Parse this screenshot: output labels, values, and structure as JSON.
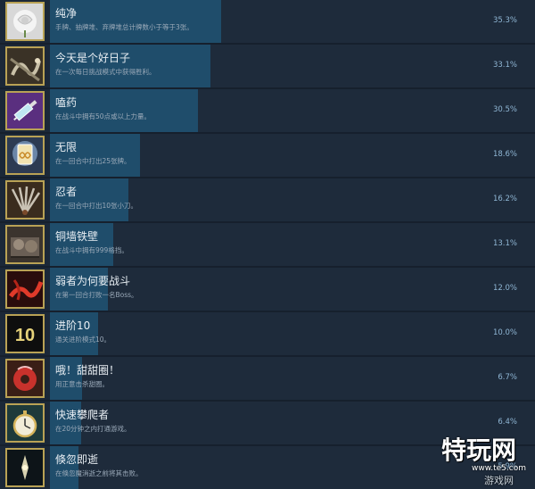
{
  "achievements": [
    {
      "icon": "white-rose-icon",
      "title": "纯净",
      "desc": "手牌、抽牌堆、弃牌堆总计牌数小于等于3张。",
      "percent": "35.3%",
      "progress": 35.3,
      "bg": "#d8d8d8"
    },
    {
      "icon": "serpent-coil-icon",
      "title": "今天是个好日子",
      "desc": "在一次每日挑战模式中获得胜利。",
      "percent": "33.1%",
      "progress": 33.1,
      "bg": "#3a3226"
    },
    {
      "icon": "syringe-icon",
      "title": "嗑药",
      "desc": "在战斗中拥有50点或以上力量。",
      "percent": "30.5%",
      "progress": 30.5,
      "bg": "#4a2a6a"
    },
    {
      "icon": "infinity-card-icon",
      "title": "无限",
      "desc": "在一回合中打出25张牌。",
      "percent": "18.6%",
      "progress": 18.6,
      "bg": "#2d3b52"
    },
    {
      "icon": "dagger-fan-icon",
      "title": "忍者",
      "desc": "在一回合中打出10张小刀。",
      "percent": "16.2%",
      "progress": 16.2,
      "bg": "#3a2c1e"
    },
    {
      "icon": "iron-wall-icon",
      "title": "铜墙铁壁",
      "desc": "在战斗中拥有999格挡。",
      "percent": "13.1%",
      "progress": 13.1,
      "bg": "#3b342e"
    },
    {
      "icon": "red-tendril-icon",
      "title": "弱者为何要战斗",
      "desc": "在第一回合打败一名Boss。",
      "percent": "12.0%",
      "progress": 12.0,
      "bg": "#3a1414"
    },
    {
      "icon": "ascension-10-icon",
      "title": "进阶10",
      "desc": "通关进阶模式10。",
      "percent": "10.0%",
      "progress": 10.0,
      "bg": "#141414"
    },
    {
      "icon": "donut-icon",
      "title": "哦！甜甜圈！",
      "desc": "用正意击杀甜圈。",
      "percent": "6.7%",
      "progress": 6.7,
      "bg": "#3a1e16"
    },
    {
      "icon": "pocket-watch-icon",
      "title": "快速攀爬者",
      "desc": "在20分钟之内打通游戏。",
      "percent": "6.4%",
      "progress": 6.4,
      "bg": "#1e3a3a"
    },
    {
      "icon": "shadow-figure-icon",
      "title": "倏忽即逝",
      "desc": "在倏忽魔消逝之前将其击败。",
      "percent": "5.9%",
      "progress": 5.9,
      "bg": "#161d22"
    }
  ],
  "watermark": {
    "main": "特玩网",
    "sub": "www.te5.com",
    "side": "游戏网"
  }
}
